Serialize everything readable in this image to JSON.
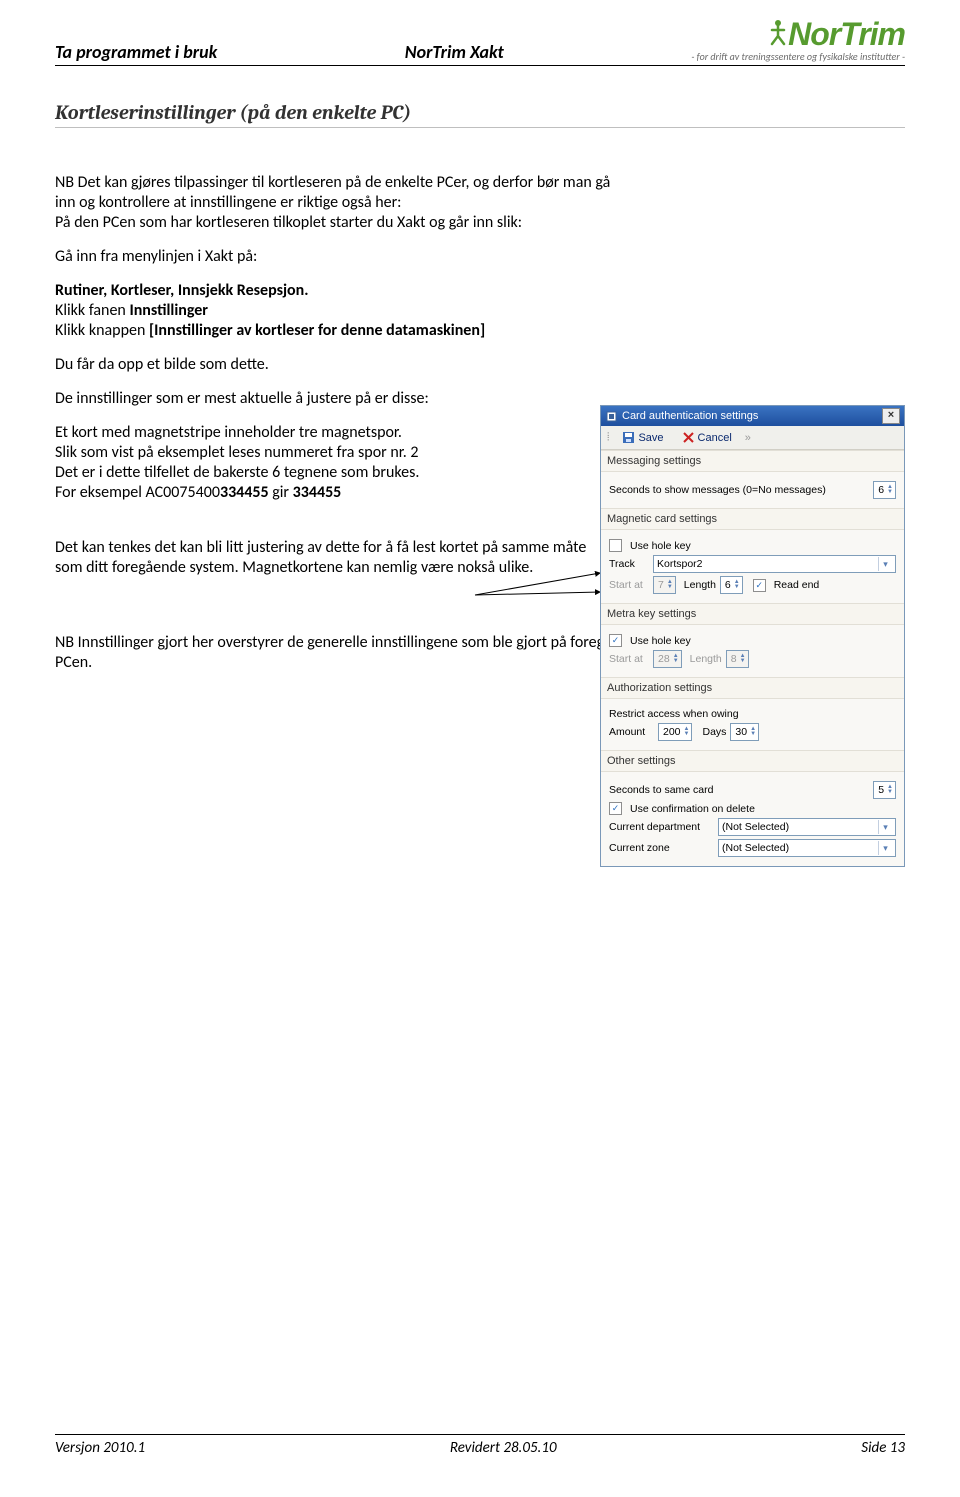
{
  "header": {
    "left": "Ta programmet i bruk",
    "center": "NorTrim Xakt",
    "brand": "NorTrim",
    "tagline": "- for drift av treningssentere og fysikalske institutter -"
  },
  "title": "Kortleserinstillinger (på den enkelte PC)",
  "para": {
    "p1a": "NB Det kan gjøres tilpassinger til kortleseren på de enkelte PCer, og derfor bør man gå inn og kontrollere at innstillingene er riktige også her:",
    "p1b": "På den PCen som har kortleseren tilkoplet starter du Xakt og går inn slik:",
    "p2": "Gå inn fra menylinjen i Xakt på:",
    "p3": "Rutiner, Kortleser, Innsjekk Resepsjon.",
    "p4a": "Klikk fanen ",
    "p4b": "Innstillinger",
    "p5a": "Klikk knappen ",
    "p5b": "[Innstillinger av kortleser for denne datamaskinen]",
    "p6": "Du får da opp et bilde som dette.",
    "p7": "De innstillinger som er mest aktuelle å justere på er disse:",
    "p8a": "Et kort med magnetstripe inneholder tre magnetspor.",
    "p8b": "Slik som vist på eksemplet leses nummeret fra spor nr. 2",
    "p8c": "Det er i dette tilfellet de bakerste 6 tegnene som brukes.",
    "p8d1": "For eksempel  AC0075400",
    "p8d2": "334455",
    "p8d3": "   gir   ",
    "p8d4": "334455",
    "p9": "Det kan tenkes det kan bli litt justering av dette for å få lest kortet på samme måte som ditt foregående system. Magnetkortene kan nemlig være nokså ulike.",
    "p10": "NB Innstillinger gjort her overstyrer de generelle innstillingene som ble gjort på foregående side, men gjelder BARE for denne PCen."
  },
  "dialog": {
    "title": "Card authentication settings",
    "save": "Save",
    "cancel": "Cancel",
    "sections": {
      "msg": {
        "header": "Messaging settings",
        "lbl1": "Seconds to show messages (0=No messages)",
        "val1": "6"
      },
      "mag": {
        "header": "Magnetic card settings",
        "useHole": "Use hole key",
        "trackLbl": "Track",
        "trackVal": "Kortspor2",
        "startLbl": "Start at",
        "startVal": "7",
        "lenLbl": "Length",
        "lenVal": "6",
        "readEnd": "Read end"
      },
      "metra": {
        "header": "Metra key settings",
        "useHole": "Use hole key",
        "startLbl": "Start at",
        "startVal": "28",
        "lenLbl": "Length",
        "lenVal": "8"
      },
      "auth": {
        "header": "Authorization settings",
        "restrict": "Restrict access when owing",
        "amountLbl": "Amount",
        "amountVal": "200",
        "daysLbl": "Days",
        "daysVal": "30"
      },
      "other": {
        "header": "Other settings",
        "secSame": "Seconds to same card",
        "secSameVal": "5",
        "confirmDel": "Use confirmation on delete",
        "deptLbl": "Current department",
        "deptVal": "(Not Selected)",
        "zoneLbl": "Current zone",
        "zoneVal": "(Not Selected)"
      }
    }
  },
  "footer": {
    "left": "Versjon 2010.1",
    "center": "Revidert 28.05.10",
    "right": "Side 13"
  }
}
